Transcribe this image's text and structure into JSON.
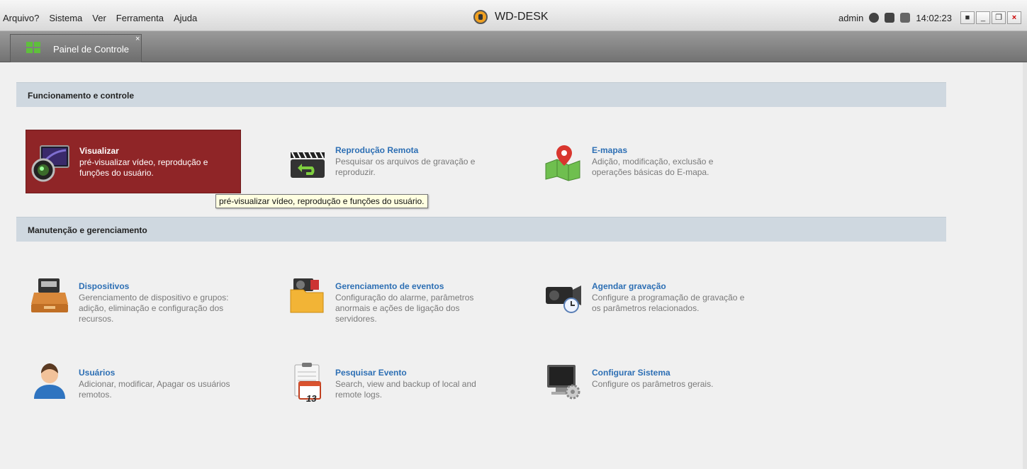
{
  "menubar": {
    "items": [
      "Arquivo?",
      "Sistema",
      "Ver",
      "Ferramenta",
      "Ajuda"
    ],
    "app_title": "WD-DESK",
    "user": "admin",
    "clock": "14:02:23",
    "icons": [
      "globe-icon",
      "monitor-icon",
      "network-icon",
      "lock-icon",
      "minimize-icon",
      "restore-icon",
      "close-icon"
    ]
  },
  "tabs": [
    {
      "label": "Painel de Controle",
      "close": "×"
    }
  ],
  "sections": {
    "operation": {
      "title": "Funcionamento e controle"
    },
    "maintenance": {
      "title": "Manutenção e gerenciamento"
    }
  },
  "items": {
    "visualizar": {
      "title": "Visualizar",
      "desc": "pré-visualizar vídeo, reprodução e funções do usuário."
    },
    "reproducao": {
      "title": "Reprodução Remota",
      "desc": "Pesquisar os arquivos de gravação e reproduzir."
    },
    "emapas": {
      "title": "E-mapas",
      "desc": "Adição, modificação, exclusão e operações básicas do E-mapa."
    },
    "dispositivos": {
      "title": "Dispositivos",
      "desc": "Gerenciamento de dispositivo e grupos: adição, eliminação e configuração dos recursos."
    },
    "eventos": {
      "title": "Gerenciamento de eventos",
      "desc": "Configuração do alarme, parâmetros anormais e ações de ligação dos servidores."
    },
    "agendar": {
      "title": "Agendar gravação",
      "desc": "Configure a programação de gravação e os parâmetros relacionados."
    },
    "usuarios": {
      "title": "Usuários",
      "desc": "Adicionar, modificar, Apagar os usuários remotos."
    },
    "pesquisar": {
      "title": "Pesquisar Evento",
      "desc": "Search, view and backup of local and remote logs.",
      "calendar_day": "13"
    },
    "configurar": {
      "title": "Configurar Sistema",
      "desc": "Configure os parâmetros gerais."
    }
  },
  "tooltip": "pré-visualizar vídeo, reprodução e funções do usuário.",
  "colors": {
    "accent": "#2d6fb4",
    "active": "#8f2527",
    "section": "#cfd8e0"
  }
}
